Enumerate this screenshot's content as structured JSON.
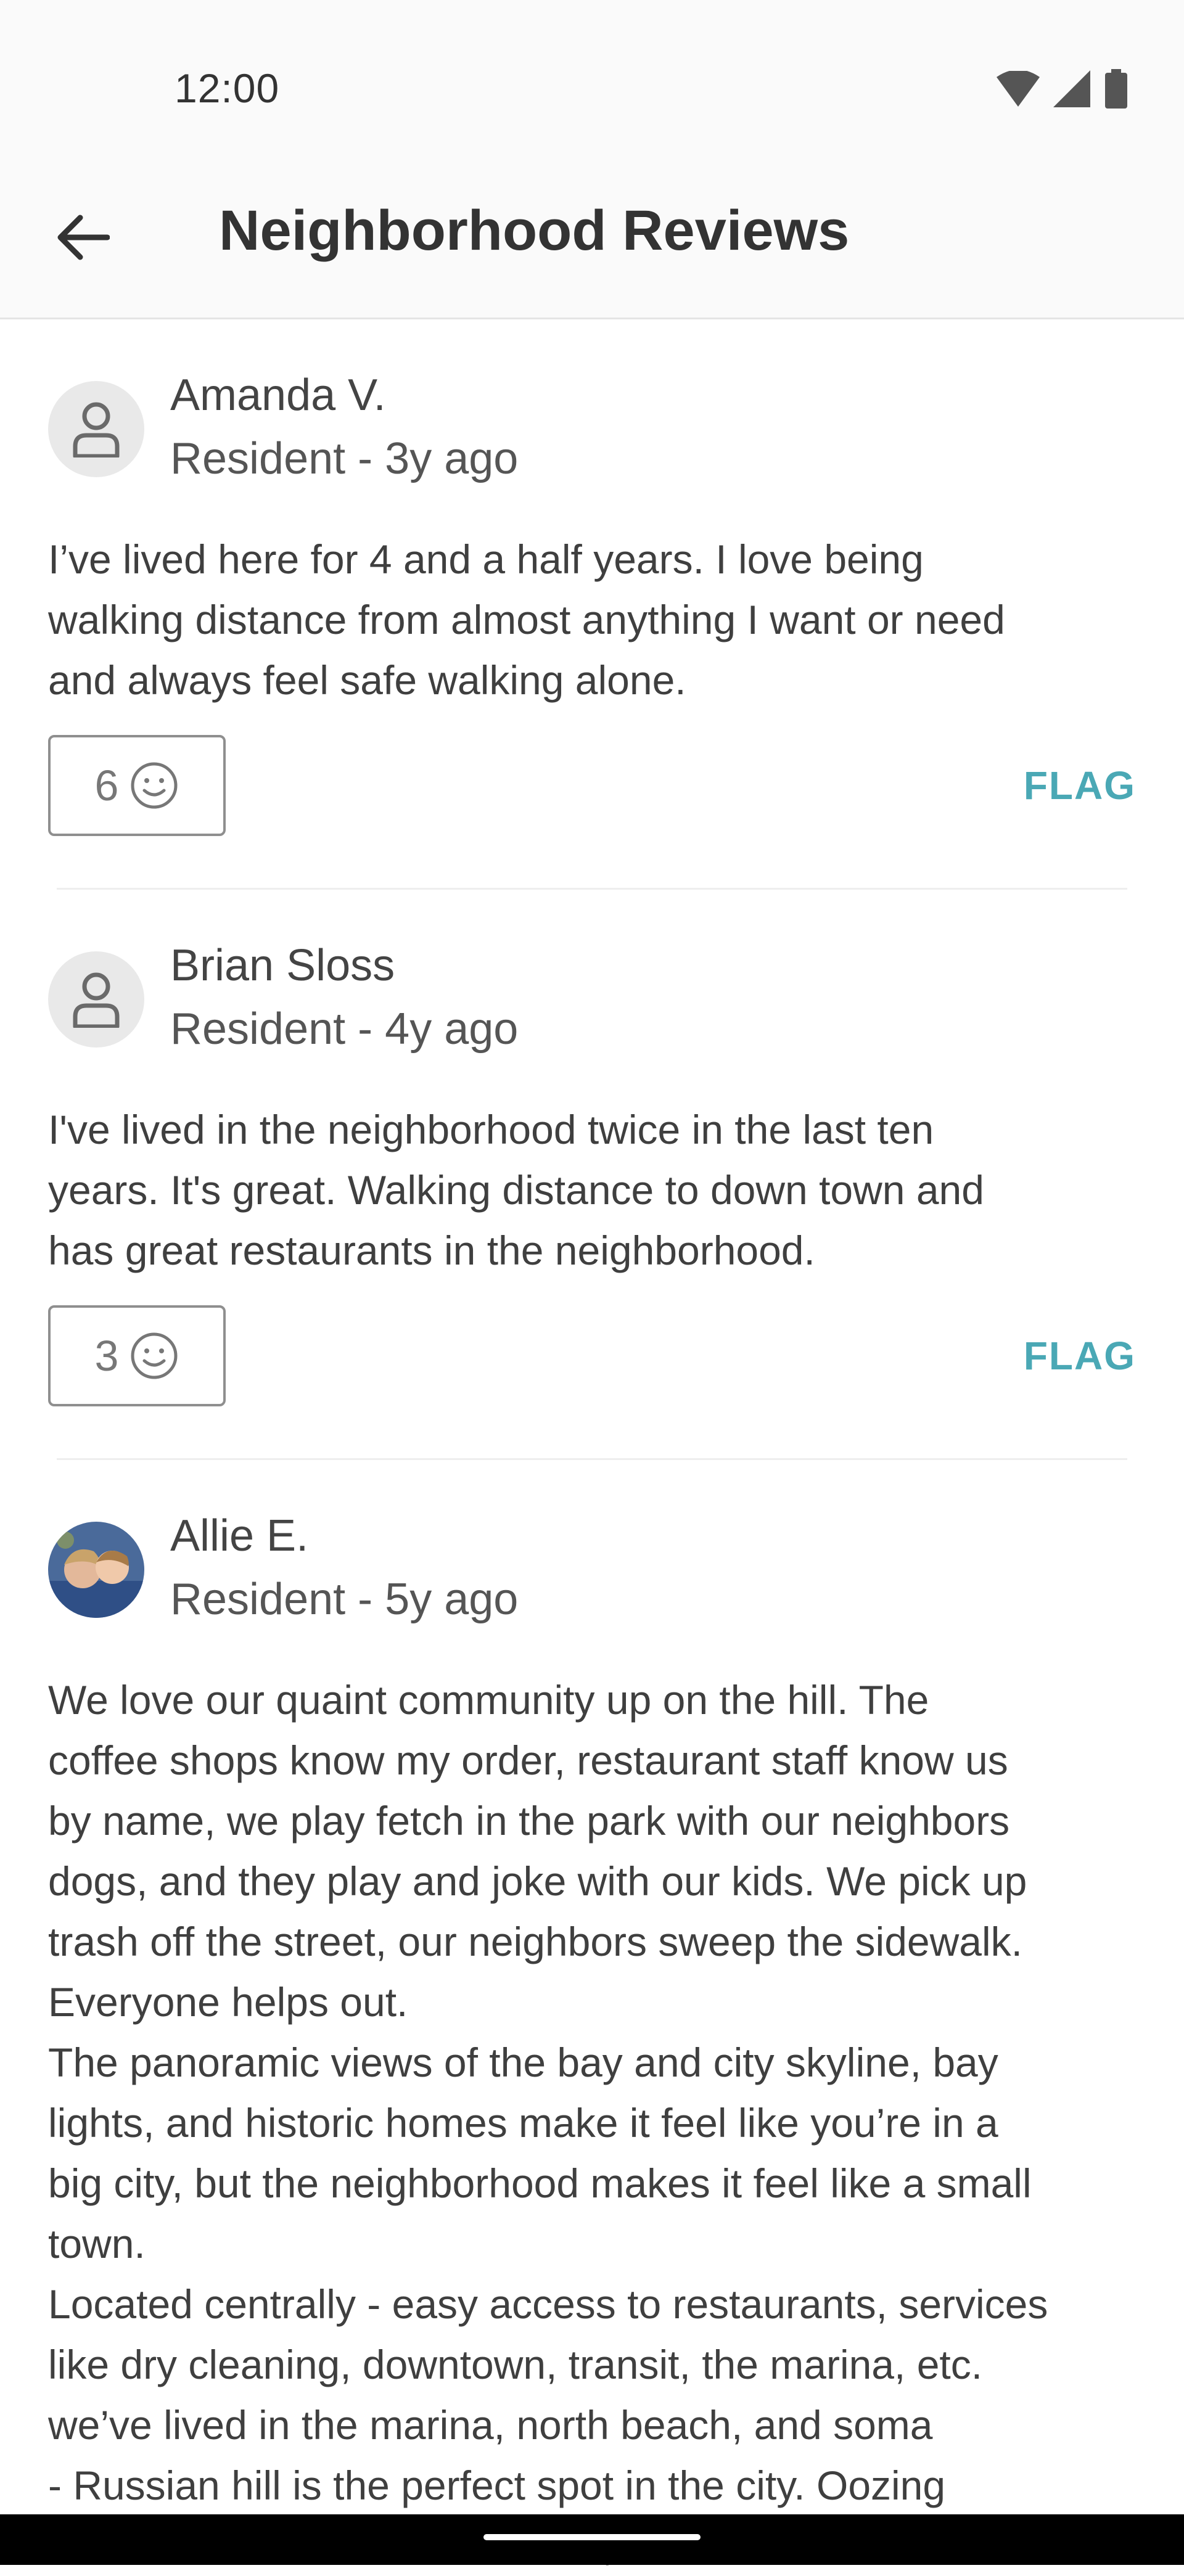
{
  "status_bar": {
    "time": "12:00"
  },
  "app_bar": {
    "title": "Neighborhood Reviews"
  },
  "reviews": [
    {
      "name": "Amanda V.",
      "meta": "Resident - 3y ago",
      "text": "I’ve lived here for 4 and a half years. I love being\nwalking distance from almost anything I want or need\nand always feel safe walking alone.",
      "likes": "6",
      "flag_label": "FLAG"
    },
    {
      "name": "Brian Sloss",
      "meta": "Resident - 4y ago",
      "text": "I've lived in the neighborhood twice in the last ten\nyears. It's great. Walking distance to down town and\nhas great restaurants in the neighborhood.",
      "likes": "3",
      "flag_label": "FLAG"
    },
    {
      "name": "Allie E.",
      "meta": "Resident - 5y ago",
      "text": "We love our quaint community up on the hill. The\ncoffee shops know my order, restaurant staff know us\nby name, we play fetch in the park with our neighbors\ndogs, and they play and joke with our kids. We pick up\ntrash off the street, our neighbors sweep the sidewalk.\nEveryone helps out.\nThe panoramic views of the bay and city skyline, bay\nlights, and historic homes make it feel like you’re in a\nbig city, but the neighborhood makes it feel like a small\ntown.\nLocated centrally - easy access to restaurants, services\nlike dry cleaning, downtown, transit, the marina, etc.\nwe’ve lived in the marina, north beach, and soma\n- Russian hill is the perfect spot in the city. Oozing\nw character and filled with kind, familiar faces and"
    }
  ],
  "colors": {
    "accent": "#4aa8b5",
    "text": "#444444"
  }
}
